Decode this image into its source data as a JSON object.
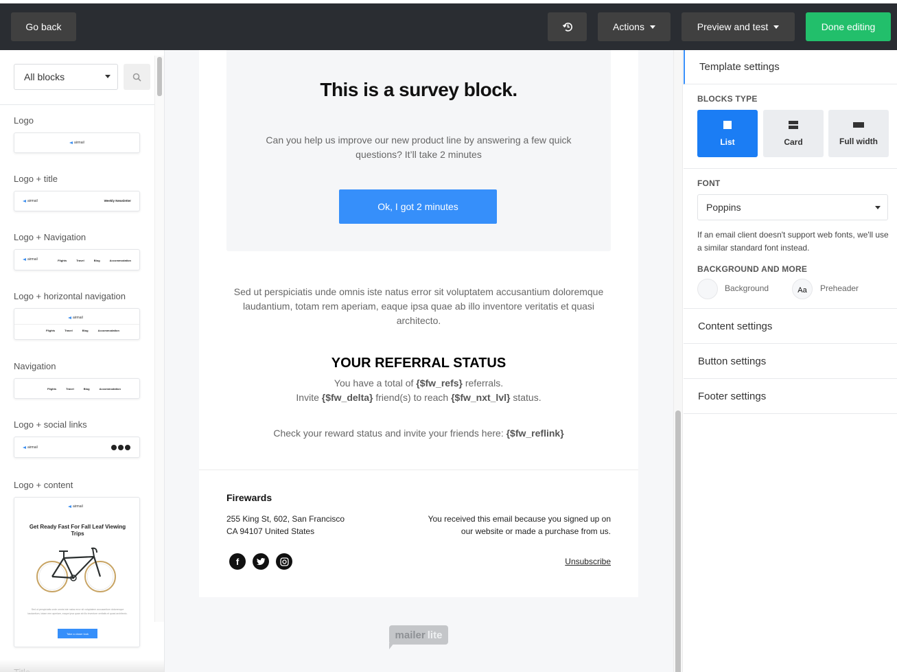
{
  "toolbar": {
    "go_back": "Go back",
    "history_icon": "history-icon",
    "actions": "Actions",
    "preview": "Preview and test",
    "done": "Done editing",
    "done_color": "#22bf6b"
  },
  "sidebar": {
    "filter_value": "All blocks",
    "search_icon": "search-icon",
    "blocks": [
      {
        "label": "Logo",
        "logo": "airmail"
      },
      {
        "label": "Logo + title",
        "logo": "airmail",
        "title": "Weekly Newsletter"
      },
      {
        "label": "Logo + Navigation",
        "logo": "airmail",
        "nav": [
          "Flights",
          "Travel",
          "Blog",
          "Accommodation"
        ]
      },
      {
        "label": "Logo + horizontal navigation",
        "logo": "airmail",
        "nav": [
          "Flights",
          "Travel",
          "Blog",
          "Accommodation"
        ]
      },
      {
        "label": "Navigation",
        "nav": [
          "Flights",
          "Travel",
          "Blog",
          "Accommodation"
        ]
      },
      {
        "label": "Logo + social links",
        "logo": "airmail"
      },
      {
        "label": "Logo + content",
        "logo": "airmail",
        "title": "Get Ready Fast For Fall Leaf Viewing Trips",
        "text": "Sed ut perspiciatis unde omnis iste natus error sit voluptatem accusantium doloremque laudantium, totam rem aperiam, eaque ipsa quae ab illo inventore veritatis et quasi architecto.",
        "button": "Take a closer look"
      },
      {
        "label": "Title"
      }
    ]
  },
  "email": {
    "survey": {
      "title": "This is a survey block.",
      "text": "Can you help us improve our new product line by answering a few quick questions? It’ll take 2 minutes",
      "button": "Ok, I got 2 minutes",
      "button_color": "#368ffa"
    },
    "lorem": "Sed ut perspiciatis unde omnis iste natus error sit voluptatem accusantium doloremque laudantium, totam rem aperiam, eaque ipsa quae ab illo inventore veritatis et quasi architecto.",
    "referral": {
      "title": "YOUR REFERRAL STATUS",
      "line1_pre": "You have a total of ",
      "line1_var": "{$fw_refs}",
      "line1_post": " referrals.",
      "line2_pre": "Invite ",
      "line2_var1": "{$fw_delta}",
      "line2_mid": " friend(s) to reach ",
      "line2_var2": "{$fw_nxt_lvl}",
      "line2_post": " status.",
      "line3_pre": "Check your reward status and invite your friends here: ",
      "line3_var": "{$fw_reflink}"
    },
    "footer": {
      "company": "Firewards",
      "address1": "255 King St, 602, San Francisco",
      "address2": "CA 94107 United States",
      "reason": "You received this email because you signed up on our website or made a purchase from us.",
      "unsubscribe": "Unsubscribe",
      "social": [
        "facebook-icon",
        "twitter-icon",
        "instagram-icon"
      ]
    },
    "brand": {
      "part1": "mailer",
      "part2": "lite"
    }
  },
  "panel": {
    "title": "Template settings",
    "blocks_type_label": "BLOCKS TYPE",
    "blocks_types": [
      {
        "label": "List",
        "active": true
      },
      {
        "label": "Card",
        "active": false
      },
      {
        "label": "Full width",
        "active": false
      }
    ],
    "font_label": "FONT",
    "font_value": "Poppins",
    "font_help": "If an email client doesn't support web fonts, we'll use a similar standard font instead.",
    "bg_label": "BACKGROUND AND MORE",
    "background": "Background",
    "preheader_glyph": "Aa",
    "preheader": "Preheader",
    "sections": [
      "Content settings",
      "Button settings",
      "Footer settings"
    ],
    "accent": "#1b7df4"
  }
}
